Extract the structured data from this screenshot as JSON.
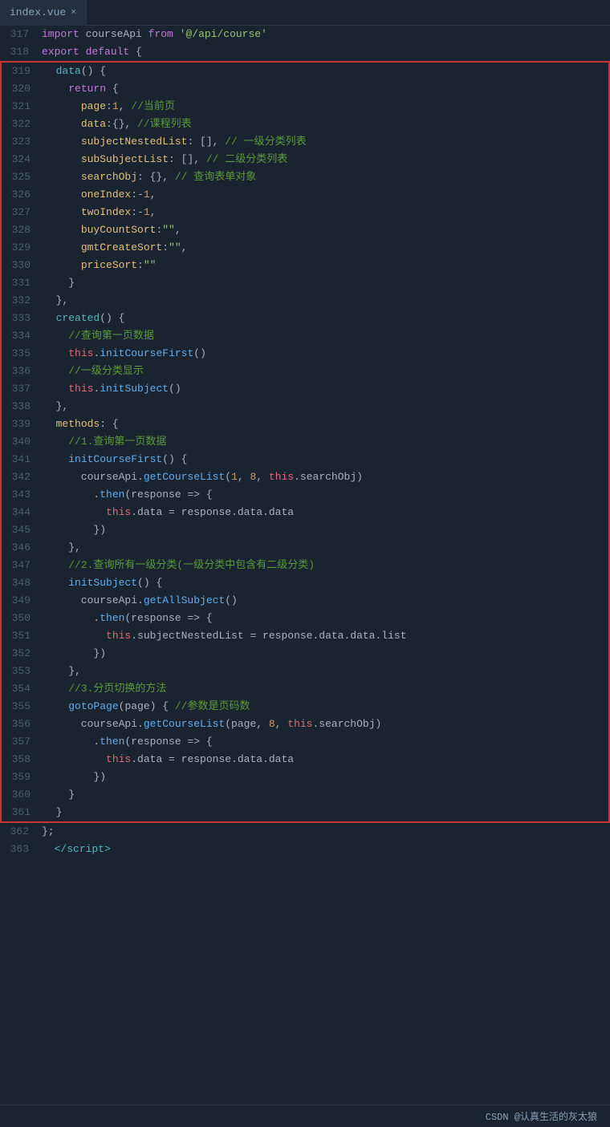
{
  "tab": {
    "filename": "index.vue",
    "close_icon": "×"
  },
  "footer": {
    "brand": "CSDN @认真生活的灰太狼"
  },
  "lines": [
    {
      "num": "317",
      "type": "normal"
    },
    {
      "num": "318",
      "type": "normal"
    },
    {
      "num": "319",
      "type": "highlight"
    },
    {
      "num": "320",
      "type": "highlight"
    },
    {
      "num": "321",
      "type": "highlight"
    },
    {
      "num": "322",
      "type": "highlight"
    },
    {
      "num": "323",
      "type": "highlight"
    },
    {
      "num": "324",
      "type": "highlight"
    },
    {
      "num": "325",
      "type": "highlight"
    },
    {
      "num": "326",
      "type": "highlight"
    },
    {
      "num": "327",
      "type": "highlight"
    },
    {
      "num": "328",
      "type": "highlight"
    },
    {
      "num": "329",
      "type": "highlight"
    },
    {
      "num": "330",
      "type": "highlight"
    },
    {
      "num": "331",
      "type": "highlight"
    },
    {
      "num": "332",
      "type": "highlight"
    },
    {
      "num": "333",
      "type": "highlight"
    },
    {
      "num": "334",
      "type": "highlight"
    },
    {
      "num": "335",
      "type": "highlight"
    },
    {
      "num": "336",
      "type": "highlight"
    },
    {
      "num": "337",
      "type": "highlight"
    },
    {
      "num": "338",
      "type": "highlight"
    },
    {
      "num": "339",
      "type": "highlight"
    },
    {
      "num": "340",
      "type": "highlight"
    },
    {
      "num": "341",
      "type": "highlight"
    },
    {
      "num": "342",
      "type": "highlight"
    },
    {
      "num": "343",
      "type": "highlight"
    },
    {
      "num": "344",
      "type": "highlight"
    },
    {
      "num": "345",
      "type": "highlight"
    },
    {
      "num": "346",
      "type": "highlight"
    },
    {
      "num": "347",
      "type": "highlight"
    },
    {
      "num": "348",
      "type": "highlight"
    },
    {
      "num": "349",
      "type": "highlight"
    },
    {
      "num": "350",
      "type": "highlight"
    },
    {
      "num": "351",
      "type": "highlight"
    },
    {
      "num": "352",
      "type": "highlight"
    },
    {
      "num": "353",
      "type": "highlight"
    },
    {
      "num": "354",
      "type": "highlight"
    },
    {
      "num": "355",
      "type": "highlight"
    },
    {
      "num": "356",
      "type": "highlight"
    },
    {
      "num": "357",
      "type": "highlight"
    },
    {
      "num": "358",
      "type": "highlight"
    },
    {
      "num": "359",
      "type": "highlight"
    },
    {
      "num": "360",
      "type": "highlight"
    },
    {
      "num": "361",
      "type": "highlight"
    },
    {
      "num": "362",
      "type": "normal"
    },
    {
      "num": "363",
      "type": "normal"
    }
  ]
}
